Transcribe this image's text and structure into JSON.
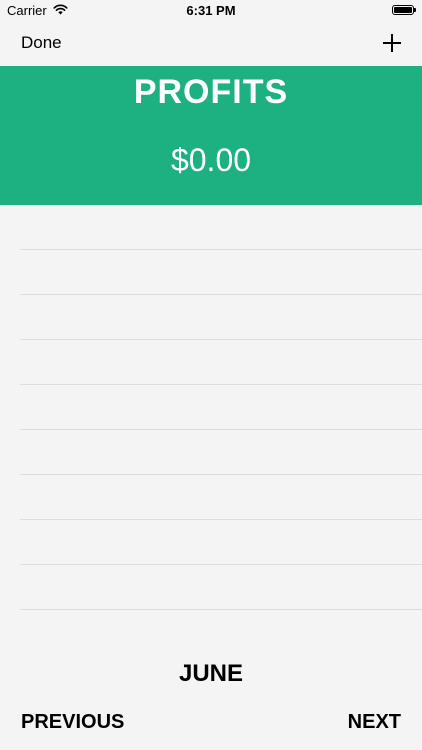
{
  "status_bar": {
    "carrier": "Carrier",
    "time": "6:31 PM",
    "wifi_icon": "wifi-icon",
    "battery_icon": "battery-icon",
    "battery_level": 1.0
  },
  "nav": {
    "done_label": "Done",
    "add_icon": "plus-icon"
  },
  "banner": {
    "title": "PROFITS",
    "amount": "$0.00",
    "color": "#1db080"
  },
  "list": {
    "row_count": 9
  },
  "footer": {
    "month": "JUNE",
    "previous_label": "PREVIOUS",
    "next_label": "NEXT"
  }
}
